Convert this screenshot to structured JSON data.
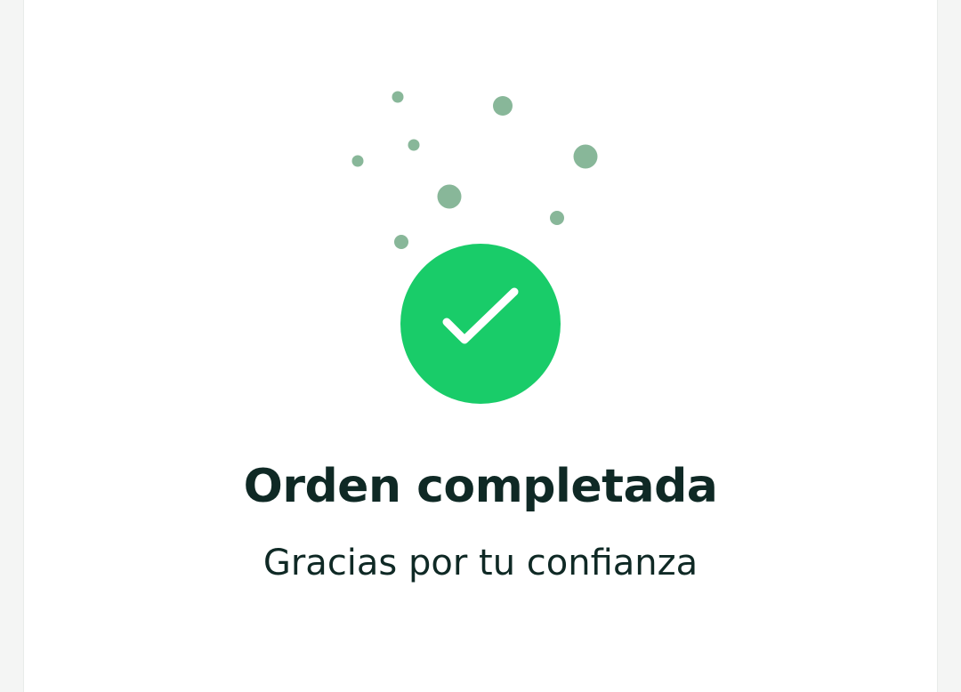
{
  "confirmation": {
    "title": "Orden completada",
    "subtitle": "Gracias por tu confianza"
  },
  "icons": {
    "badge": "check-icon",
    "decoration": "confetti-dots"
  },
  "colors": {
    "page_background": "#f4f5f4",
    "card_background": "#ffffff",
    "success_green": "#19cc69",
    "check_mark": "#ffffff",
    "confetti": "#88b799",
    "text": "#0f2925"
  }
}
